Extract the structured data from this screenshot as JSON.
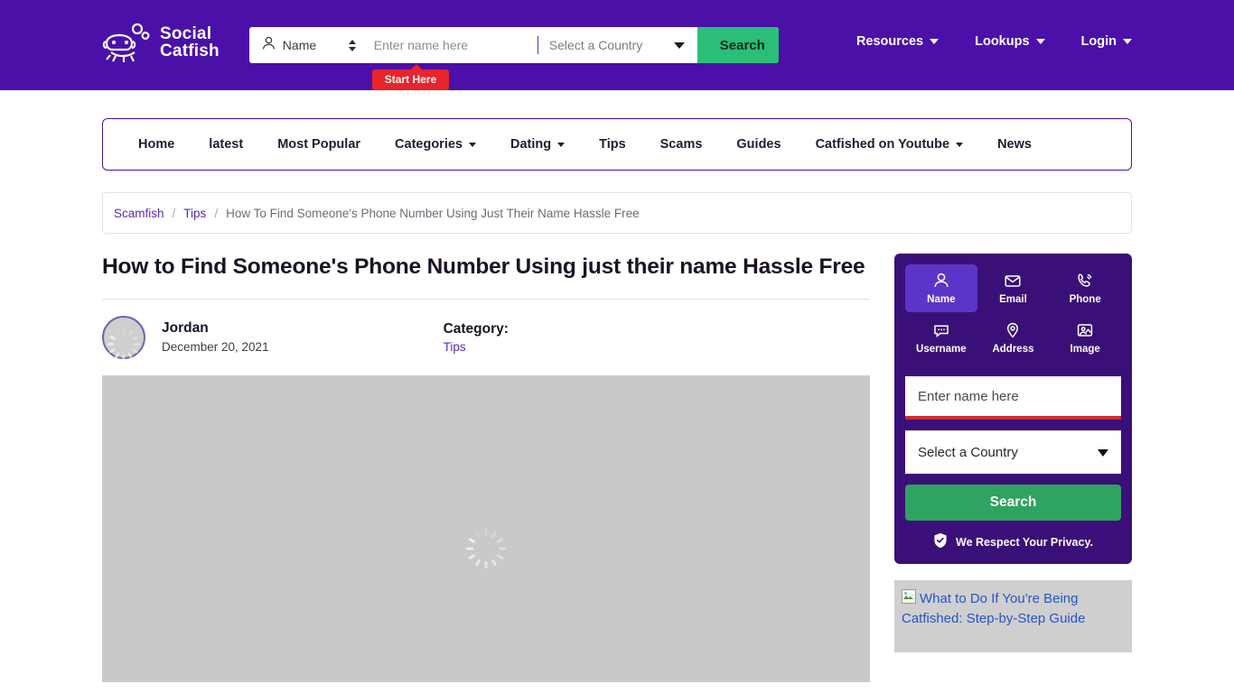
{
  "colors": {
    "header_purple": "#4A10A8",
    "widget_purple": "#3A1078",
    "tab_active_purple": "#5B35C8",
    "header_green": "#2BBE78",
    "sidebar_green": "#2FA360",
    "badge_red": "#E8242C",
    "link_purple": "#5B2BB5",
    "underline_red": "#D32A32"
  },
  "header": {
    "logo": {
      "icon": "catfish-logo-icon",
      "line1": "Social",
      "line2": "Catfish"
    },
    "search": {
      "type_icon": "person-icon",
      "type_label": "Name",
      "stepper_icon": "up-down-stepper-icon",
      "name_placeholder": "Enter name here",
      "name_value": "",
      "country_label": "Select a Country",
      "country_caret_icon": "chevron-down-icon",
      "button_label": "Search",
      "start_here_label": "Start Here"
    },
    "nav": [
      {
        "label": "Resources",
        "has_caret": true
      },
      {
        "label": "Lookups",
        "has_caret": true
      },
      {
        "label": "Login",
        "has_caret": true
      }
    ]
  },
  "mainnav": [
    {
      "label": "Home",
      "has_caret": false
    },
    {
      "label": "latest",
      "has_caret": false
    },
    {
      "label": "Most Popular",
      "has_caret": false
    },
    {
      "label": "Categories",
      "has_caret": true
    },
    {
      "label": "Dating",
      "has_caret": true
    },
    {
      "label": "Tips",
      "has_caret": false
    },
    {
      "label": "Scams",
      "has_caret": false
    },
    {
      "label": "Guides",
      "has_caret": false
    },
    {
      "label": "Catfished on Youtube",
      "has_caret": true
    },
    {
      "label": "News",
      "has_caret": false
    }
  ],
  "breadcrumb": {
    "items": [
      {
        "label": "Scamfish",
        "link": true
      },
      {
        "label": "Tips",
        "link": true
      }
    ],
    "separator": "/",
    "current": "How To Find Someone's Phone Number Using Just Their Name Hassle Free"
  },
  "article": {
    "title": "How to Find Someone's Phone Number Using just their name Hassle Free",
    "author": "Jordan",
    "date": "December 20, 2021",
    "category_label": "Category:",
    "category_value": "Tips",
    "avatar_icon": "loading-spinner-icon",
    "hero_icon": "loading-spinner-icon"
  },
  "sidebar": {
    "tabs": [
      {
        "label": "Name",
        "icon": "person-icon",
        "active": true
      },
      {
        "label": "Email",
        "icon": "envelope-icon",
        "active": false
      },
      {
        "label": "Phone",
        "icon": "phone-ring-icon",
        "active": false
      },
      {
        "label": "Username",
        "icon": "chat-bubble-icon",
        "active": false
      },
      {
        "label": "Address",
        "icon": "map-pin-icon",
        "active": false
      },
      {
        "label": "Image",
        "icon": "photo-person-icon",
        "active": false
      }
    ],
    "name_placeholder": "Enter name here",
    "name_value": "",
    "country_label": "Select a Country",
    "country_caret_icon": "chevron-down-icon",
    "search_button": "Search",
    "privacy_icon": "shield-check-icon",
    "privacy_text": "We Respect Your Privacy.",
    "promo_image_alt": "What to Do If You're Being Catfished: Step-by-Step Guide",
    "promo_image_icon": "broken-image-icon"
  }
}
